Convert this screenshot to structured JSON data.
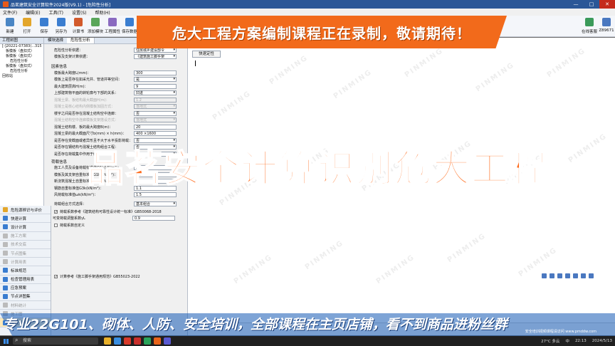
{
  "window": {
    "title": "品茗建筑安全计算软件2024版(V9.1) - [危险性分析]",
    "controls": [
      "—",
      "□",
      "✕"
    ]
  },
  "menu": [
    "文件(F)",
    "编辑(E)",
    "工具(T)",
    "设置(S)",
    "帮助(H)"
  ],
  "toolbar": {
    "buttons": [
      {
        "label": "新建",
        "color": "#4a86c5"
      },
      {
        "label": "打开",
        "color": "#e3a62b"
      },
      {
        "label": "保存",
        "color": "#3a7dd0"
      },
      {
        "label": "另存为",
        "color": "#3a7dd0"
      },
      {
        "label": "计算书",
        "color": "#d25a2c"
      },
      {
        "label": "添加模块",
        "color": "#5aa65a"
      },
      {
        "label": "工程属性",
        "color": "#8a6ac0"
      },
      {
        "label": "保存数据",
        "color": "#3a7dd0"
      },
      {
        "label": "调用数据",
        "color": "#3a7dd0"
      }
    ],
    "right_buttons": [
      {
        "label": "在线客服",
        "color": "#3a9a5a"
      },
      {
        "label": "Z89671",
        "color": "#4a78c0"
      }
    ]
  },
  "banner": {
    "text": "危大工程方案编制课程正在录制，敬请期待！"
  },
  "tree": {
    "header": "工程树图",
    "items": [
      {
        "level": 0,
        "label": "[-]20221-07383(...315"
      },
      {
        "level": 1,
        "label": "板模板（盘扣式）"
      },
      {
        "level": 1,
        "label": "板模板（盘扣式）"
      },
      {
        "level": 2,
        "label": "危险性分析"
      },
      {
        "level": 1,
        "label": "板模板（盘扣式）"
      },
      {
        "level": 2,
        "label": "危险性分析"
      },
      {
        "level": 0,
        "label": "回收站"
      }
    ]
  },
  "nav": {
    "items": [
      {
        "label": "危险源辨识与评价",
        "color": "#e3a62b",
        "state": "normal"
      },
      {
        "label": "快速计算",
        "color": "#3a7dd0",
        "state": "normal"
      },
      {
        "label": "设计计算",
        "color": "#3a7dd0",
        "state": "normal"
      },
      {
        "label": "施工方案",
        "color": "#bbbbbb",
        "state": "disabled"
      },
      {
        "label": "技术交底",
        "color": "#bbbbbb",
        "state": "disabled"
      },
      {
        "label": "节点图集",
        "color": "#bbbbbb",
        "state": "disabled"
      },
      {
        "label": "计算用表",
        "color": "#bbbbbb",
        "state": "disabled"
      },
      {
        "label": "标准规范",
        "color": "#3a7dd0",
        "state": "normal"
      },
      {
        "label": "检查管理用表",
        "color": "#3a7dd0",
        "state": "normal"
      },
      {
        "label": "应急预案",
        "color": "#3a7dd0",
        "state": "normal"
      },
      {
        "label": "节点详图集",
        "color": "#3a7dd0",
        "state": "normal"
      },
      {
        "label": "材料统计",
        "color": "#bbbbbb",
        "state": "disabled"
      },
      {
        "label": "施工图",
        "color": "#bbbbbb",
        "state": "disabled"
      },
      {
        "label": "工程资料",
        "color": "#3a7dd0",
        "state": "active"
      }
    ]
  },
  "form": {
    "tabs": [
      "模块选择",
      "危险性分析"
    ],
    "top_rows": [
      {
        "label": "危险性分析依据：",
        "value": "住房城乡建设部令",
        "dim": false,
        "dropdown": true
      },
      {
        "label": "模板及支架计算依据：",
        "value": "《建筑施工脚手架",
        "dim": false,
        "dropdown": true
      }
    ],
    "section_label": "因素信息",
    "rows": [
      {
        "label": "模板最大跨度L(mm)：",
        "value": "300",
        "dim": false,
        "dropdown": false
      },
      {
        "label": "模板上是否存在如采光井、管道井等空间：",
        "value": "是",
        "dim": false,
        "dropdown": true
      },
      {
        "label": "最大建筑层高H(m)：",
        "value": "9",
        "dim": false,
        "dropdown": false
      },
      {
        "label": "上部建筑物平面的转轮廓与下部的关系：",
        "value": "凹进",
        "dim": false,
        "dropdown": true
      },
      {
        "label": "混凝土梁、板结构最大截面H(m)：",
        "value": "1.2",
        "dim": true,
        "dropdown": false
      },
      {
        "label": "混凝土是核心结构内侧模板加固方式：",
        "value": "落地式",
        "dim": true,
        "dropdown": true
      },
      {
        "label": "楼宇之间是否存在混凝土结构空中连廊：",
        "value": "否",
        "dim": false,
        "dropdown": true
      },
      {
        "label": "混凝土结构空中连廊模板支架搭设方式：",
        "value": "落地式",
        "dim": true,
        "dropdown": true
      },
      {
        "label": "混凝土结构楼、板的最大跨度B(m)：",
        "value": "20",
        "dim": false,
        "dropdown": false
      },
      {
        "label": "混凝土梁的最大截面尺寸b(mm) × h(mm)：",
        "value": "400 ×1600",
        "dim": false,
        "dropdown": false
      },
      {
        "label": "是否存在变截面或者异形且不大于水平投影荷载：",
        "value": "否",
        "dim": false,
        "dropdown": true
      },
      {
        "label": "是否存在钢结构与混凝土结构组合工程：",
        "value": "否",
        "dim": false,
        "dropdown": true
      },
      {
        "label": "是否存在荷载集中作用于结构构件以...：",
        "value": "否",
        "dim": false,
        "dropdown": true
      }
    ],
    "load_label": "荷载信息",
    "load_rows": [
      {
        "label": "施工人员及设备荷载标准值Q1k(kN/m²)：",
        "value": "2.5",
        "dim": false,
        "dropdown": false
      },
      {
        "label": "模板及其支架自重标准值G1k(kN/m²)：",
        "value": "0.3",
        "dim": false,
        "dropdown": false
      },
      {
        "label": "新浇筑混凝土自重标准值G2k(kN/m³)：",
        "value": "24",
        "dim": false,
        "dropdown": false
      },
      {
        "label": "钢筋自重标准值G3k(kN/m³)：",
        "value": "1.1",
        "dim": false,
        "dropdown": false
      },
      {
        "label": "风荷载标准值ωk(kN/m²)：",
        "value": "1.5",
        "dim": false,
        "dropdown": false
      }
    ],
    "combo": {
      "label": "荷载组合方式选择：",
      "value": "基本组合"
    },
    "check1": {
      "label": "荷载系数参考《建筑结构可靠性设计统一标准》GB50068-2018",
      "checked": true
    },
    "coef": {
      "label": "可变荷载调整系数γL",
      "value": "0.9"
    },
    "check2": {
      "label": "荷载系数自定义",
      "checked": false
    },
    "check3": {
      "label": "计算参考《施工脚手架通用规范》GB55023-2022",
      "checked": true
    }
  },
  "editor": {
    "button_label": "快速定性",
    "watermark": "PINMING"
  },
  "overlay": {
    "big_text": "品茗安全计算识别危大工程",
    "bottom_text": "专业22G101、砌体、人防、安全培训，全部课程在主页店铺，看不到商品进粉丝群",
    "bottom_sub": "安全培训视频课程请访问 www.pmddw.com"
  },
  "taskbar": {
    "search_placeholder": "搜索",
    "weather": "27°C 多云",
    "lang": "中",
    "time": "22:13",
    "date": "2024/5/13"
  }
}
